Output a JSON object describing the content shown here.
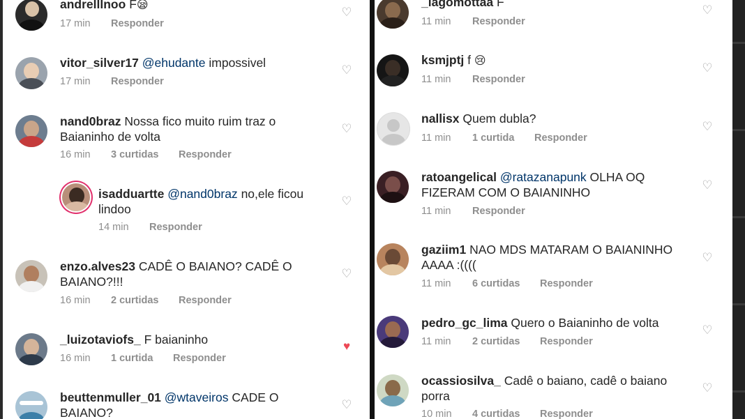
{
  "left": {
    "comments": [
      {
        "username": "andrelllnoo",
        "text": "F",
        "emoji": "😪",
        "time": "17 min",
        "likes": "",
        "reply": "Responder",
        "liked": false
      },
      {
        "username": "vitor_silver17",
        "mention": "@ehudante",
        "text": "impossivel",
        "time": "17 min",
        "likes": "",
        "reply": "Responder",
        "liked": false
      },
      {
        "username": "nand0braz",
        "text": "Nossa fico muito ruim traz o",
        "text2": "Baianinho de volta",
        "time": "16 min",
        "likes": "3 curtidas",
        "reply": "Responder",
        "liked": false
      },
      {
        "username": "isadduartte",
        "mention": "@nand0braz",
        "text": "no,ele ficou",
        "text2": "lindoo",
        "time": "14 min",
        "likes": "",
        "reply": "Responder",
        "liked": false
      },
      {
        "username": "enzo.alves23",
        "text": "CADÊ O BAIANO? CADÊ O",
        "text2": "BAIANO?!!!",
        "time": "16 min",
        "likes": "2 curtidas",
        "reply": "Responder",
        "liked": false
      },
      {
        "username": "_luizotaviofs_",
        "text": "F baianinho",
        "time": "16 min",
        "likes": "1 curtida",
        "reply": "Responder",
        "liked": true
      },
      {
        "username": "beuttenmuller_01",
        "mention": "@wtaveiros",
        "text": "CADE O",
        "text2": "BAIANO?",
        "liked": false
      }
    ]
  },
  "right": {
    "comments": [
      {
        "username": "_iagomottaa",
        "text": "F",
        "time": "11 min",
        "likes": "",
        "reply": "Responder",
        "liked": false
      },
      {
        "username": "ksmjptj",
        "text": "f",
        "emoji": "😢",
        "time": "11 min",
        "likes": "",
        "reply": "Responder",
        "liked": false
      },
      {
        "username": "nallisx",
        "text": "Quem dubla?",
        "time": "11 min",
        "likes": "1 curtida",
        "reply": "Responder",
        "liked": false
      },
      {
        "username": "ratoangelical",
        "mention": "@ratazanapunk",
        "text": "OLHA OQ",
        "text2": "FIZERAM COM O BAIANINHO",
        "time": "11 min",
        "likes": "",
        "reply": "Responder",
        "liked": false
      },
      {
        "username": "gaziim1",
        "text": "NAO MDS MATARAM O BAIANINHO",
        "text2": "AAAA :((((",
        "time": "11 min",
        "likes": "6 curtidas",
        "reply": "Responder",
        "liked": false
      },
      {
        "username": "pedro_gc_lima",
        "text": "Quero o Baianinho de volta",
        "time": "11 min",
        "likes": "2 curtidas",
        "reply": "Responder",
        "liked": false
      },
      {
        "username": "ocassiosilva_",
        "text": "Cadê o baiano, cadê o baiano",
        "text2": "porra",
        "time": "10 min",
        "likes": "4 curtidas",
        "reply": "Responder",
        "liked": false
      }
    ]
  },
  "icons": {
    "heart": "heart-icon",
    "heart_liked": "heart-filled-icon"
  },
  "colors": {
    "like": "#ed4956",
    "mention": "#003569",
    "meta": "#8e8e8e",
    "text": "#262626"
  }
}
